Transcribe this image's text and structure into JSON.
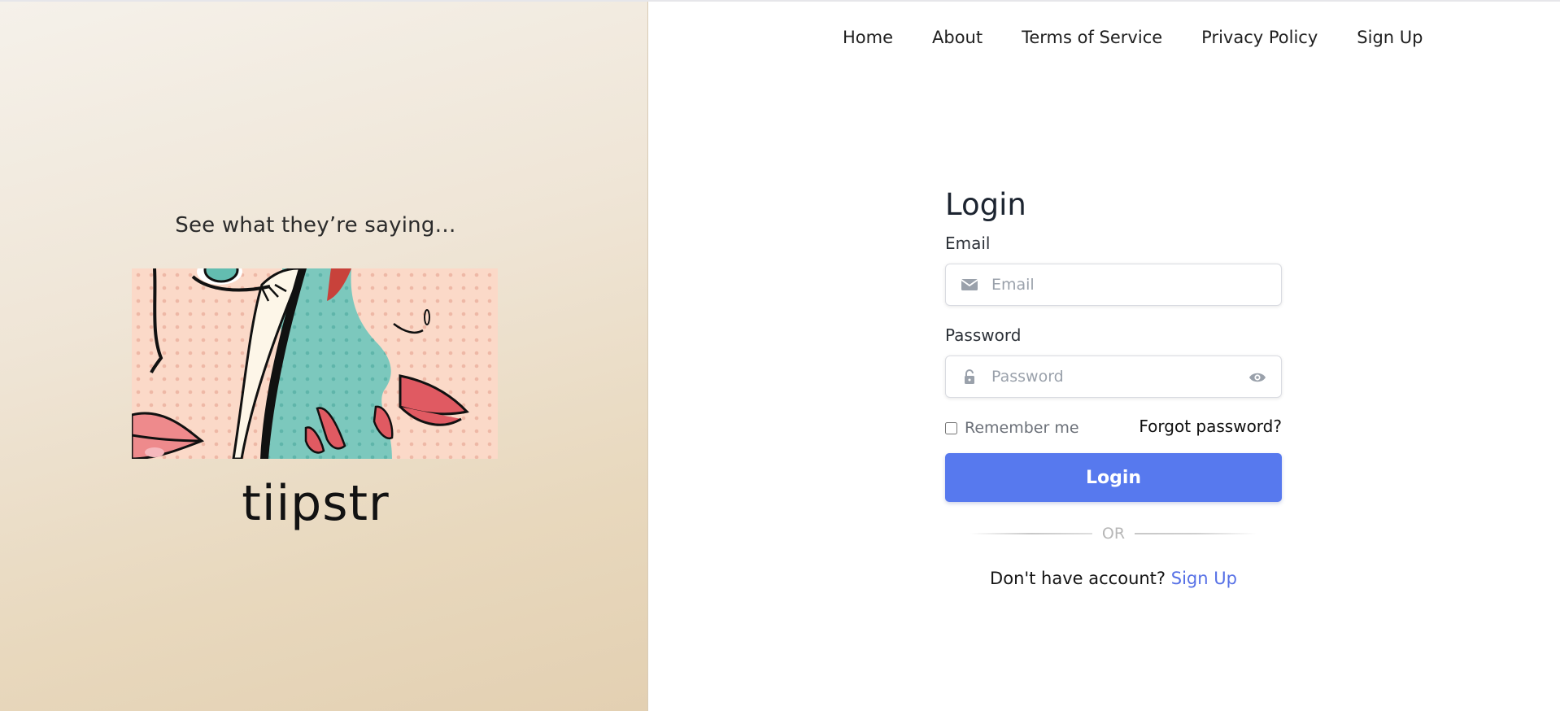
{
  "nav": {
    "items": [
      {
        "label": "Home"
      },
      {
        "label": "About"
      },
      {
        "label": "Terms of Service"
      },
      {
        "label": "Privacy Policy"
      },
      {
        "label": "Sign Up"
      }
    ]
  },
  "hero": {
    "tagline": "See what they’re saying…",
    "brand": "tiipstr"
  },
  "login": {
    "title": "Login",
    "email_label": "Email",
    "email_placeholder": "Email",
    "email_value": "",
    "password_label": "Password",
    "password_placeholder": "Password",
    "password_value": "",
    "remember_label": "Remember me",
    "remember_checked": false,
    "forgot_label": "Forgot password?",
    "submit_label": "Login",
    "divider_label": "OR",
    "no_account_text": "Don't have account?",
    "signup_link": "Sign Up"
  },
  "icons": {
    "email": "envelope-icon",
    "password": "lock-icon",
    "toggle_visibility": "eye-icon"
  },
  "colors": {
    "primary": "#5779ee",
    "link": "#5670e6",
    "panel_bg": "#ecdfca"
  }
}
